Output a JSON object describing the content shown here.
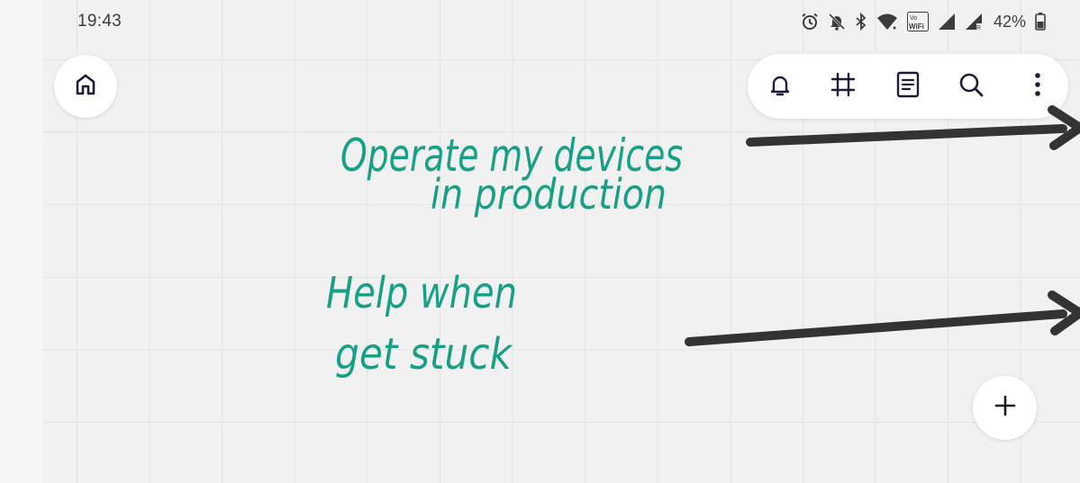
{
  "status_bar": {
    "time": "19:43",
    "battery_percent": "42%",
    "network_label": "VoWiFi",
    "icons": [
      "alarm-icon",
      "mute-notifications-icon",
      "bluetooth-icon",
      "wifi-icon",
      "vowifi-icon",
      "signal-icon",
      "signal-roaming-icon",
      "battery-icon"
    ]
  },
  "toolbar": {
    "icons": [
      "bell-icon",
      "frame-icon",
      "notes-icon",
      "search-icon",
      "more-vertical-icon"
    ]
  },
  "board": {
    "notes": [
      {
        "line1": "Operate my devices",
        "line2": "in production"
      },
      {
        "line1": "Help when",
        "line2": "get stuck"
      }
    ],
    "ink_color": "#17a085",
    "arrow_color": "#333333"
  },
  "controls": {
    "home_icon": "home-icon",
    "add_icon": "plus-icon"
  }
}
